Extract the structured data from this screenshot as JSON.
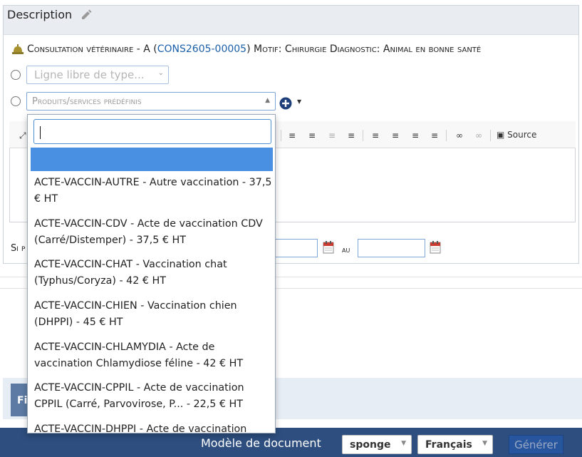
{
  "description": {
    "title": "Description",
    "edit_icon": "pencil-icon"
  },
  "consultation": {
    "prefix": "Consultation vétérinaire - A (",
    "ref": "CONS2605-00005",
    "suffix": ") Motif: Chirurgie Diagnostic: Animal en bonne santé",
    "icon": "bell-icon"
  },
  "line_type": {
    "free_placeholder": "Ligne libre de type..."
  },
  "product_select": {
    "placeholder": "Produits/services prédéfinis"
  },
  "editor": {
    "source_label": "Source"
  },
  "dates": {
    "label_partial": "Si p",
    "au_label": "au"
  },
  "dropdown": {
    "search_value": "",
    "options": [
      "ACTE-VACCIN-AUTRE - Autre vaccination - 37,5 € HT",
      "ACTE-VACCIN-CDV - Acte de vaccination CDV (Carré/Distemper) - 37,5 € HT",
      "ACTE-VACCIN-CHAT - Vaccination chat (Typhus/Coryza) - 42 € HT",
      "ACTE-VACCIN-CHIEN - Vaccination chien (DHPPI) - 45 € HT",
      "ACTE-VACCIN-CHLAMYDIA - Acte de vaccination Chlamydiose féline - 42 € HT",
      "ACTE-VACCIN-CPPIL - Acte de vaccination CPPIL (Carré, Parvovirose, P... - 22,5 € HT",
      "ACTE-VACCIN-DHPPI - Acte de vaccination"
    ]
  },
  "blue_panel": {
    "tab_label": "Fi"
  },
  "footer": {
    "model_label": "Modèle de document",
    "model_value": "sponge",
    "language_value": "Français",
    "generate_label": "Générer"
  },
  "colors": {
    "accent": "#4a90e2",
    "footer_bg": "#2d4e7e",
    "link": "#1a5fa8"
  }
}
